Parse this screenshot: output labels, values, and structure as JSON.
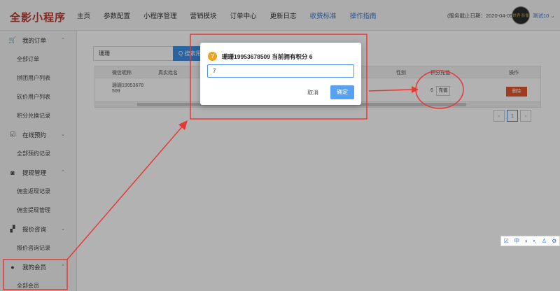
{
  "header": {
    "logo": "全影小程序",
    "nav": [
      {
        "label": "主页",
        "highlight": false
      },
      {
        "label": "参数配置",
        "highlight": false
      },
      {
        "label": "小程序管理",
        "highlight": false
      },
      {
        "label": "营销模块",
        "highlight": false
      },
      {
        "label": "订单中心",
        "highlight": false
      },
      {
        "label": "更新日志",
        "highlight": false
      },
      {
        "label": "收费标准",
        "highlight": true
      },
      {
        "label": "操作指南",
        "highlight": true
      }
    ],
    "expiry": "(服务截止日期：2020-04-05)",
    "avatar_text": "世界 影像",
    "user": "测试10 ⌄"
  },
  "sidebar": {
    "groups": [
      {
        "label": "我的订单",
        "icon": "cart-icon",
        "glyph": "🛒",
        "chev": "⌃",
        "items": [
          "全部订单",
          "拼团用户列表",
          "砍价用户列表",
          "积分兑换记录"
        ]
      },
      {
        "label": "在线预约",
        "icon": "checkbox-icon",
        "glyph": "☑",
        "chev": "⌄",
        "items": [
          "全部预约记录"
        ]
      },
      {
        "label": "提现管理",
        "icon": "money-icon",
        "glyph": "◙",
        "chev": "⌃",
        "items": [
          "佣金返现记录",
          "佣金提现管理"
        ]
      },
      {
        "label": "报价咨询",
        "icon": "chat-icon",
        "glyph": "▞",
        "chev": "⌄",
        "items": [
          "报价咨询记录"
        ]
      },
      {
        "label": "我的会员",
        "icon": "user-circle-icon",
        "glyph": "●",
        "chev": "⌃",
        "items": [
          "全部会员"
        ]
      }
    ]
  },
  "main": {
    "search_value": "珊珊",
    "search_button": "Q 搜索用户",
    "headers": [
      "微信昵称",
      "真实姓名",
      "性别",
      "积分充值",
      "操作"
    ],
    "row": {
      "nickname_line1": "珊珊19953678",
      "nickname_line2": "509",
      "points": "6",
      "charge_btn": "充值",
      "delete_btn": "删除"
    },
    "pager": {
      "prev": "‹",
      "current": "1",
      "next": "›"
    }
  },
  "modal": {
    "icon": "?",
    "title": "珊珊19953678509 当前拥有积分 6",
    "input_value": "7",
    "cancel": "取消",
    "ok": "确定"
  },
  "ime_toolbar": [
    "☑",
    "中",
    "◗",
    "•,",
    "♙",
    "⚙"
  ]
}
